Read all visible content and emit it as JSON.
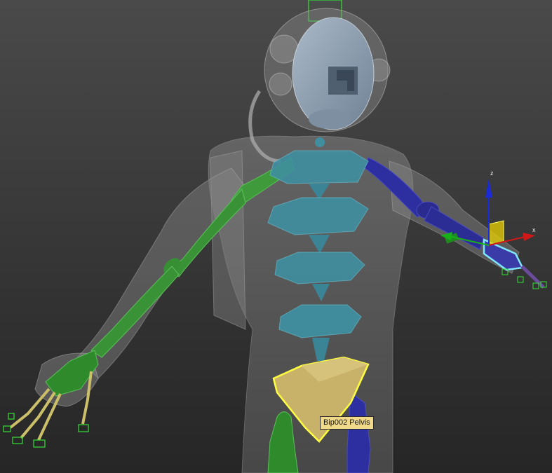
{
  "viewport": {
    "selected_object_tooltip": "Bip002 Pelvis",
    "gizmo": {
      "x_axis_label": "x",
      "z_axis_label": "z"
    }
  },
  "colors": {
    "biped_spine": "#3f8fa0",
    "biped_left_arm": "#3e9a3a",
    "biped_right_arm": "#2a2a8a",
    "biped_pelvis": "#c8b26a",
    "selection_highlight": "#ffff40",
    "hand_selection": "#7fe6ff",
    "gizmo_x": "#d01818",
    "gizmo_y": "#18b018",
    "gizmo_z": "#1a2ad8",
    "gizmo_plane": "#e8d000"
  }
}
